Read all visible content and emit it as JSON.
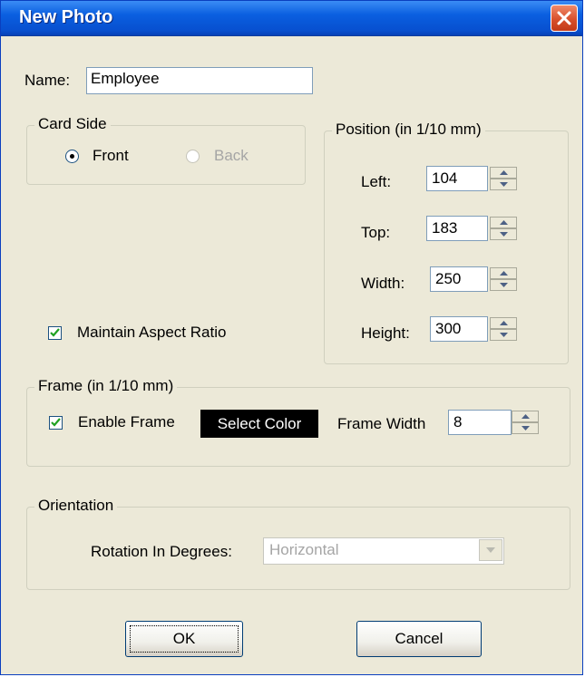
{
  "window": {
    "title": "New Photo"
  },
  "name": {
    "label": "Name:",
    "value": "Employee"
  },
  "card_side": {
    "legend": "Card Side",
    "front_label": "Front",
    "back_label": "Back",
    "selected": "Front"
  },
  "position": {
    "legend": "Position (in 1/10 mm)",
    "left_label": "Left:",
    "left_value": "104",
    "top_label": "Top:",
    "top_value": "183",
    "width_label": "Width:",
    "width_value": "250",
    "height_label": "Height:",
    "height_value": "300"
  },
  "maintain_aspect": {
    "label": "Maintain Aspect Ratio",
    "checked": true
  },
  "frame": {
    "legend": "Frame (in 1/10 mm)",
    "enable_label": "Enable Frame",
    "enabled": true,
    "select_color_label": "Select Color",
    "select_color_bg": "#000000",
    "width_label": "Frame Width",
    "width_value": "8"
  },
  "orientation": {
    "legend": "Orientation",
    "rotation_label": "Rotation In Degrees:",
    "rotation_value": "Horizontal"
  },
  "buttons": {
    "ok_label": "OK",
    "cancel_label": "Cancel"
  },
  "icons": {
    "close": "close-icon",
    "radio": "radio-icon",
    "check": "checkmark-icon",
    "spin_up": "chevron-up-icon",
    "spin_down": "chevron-down-icon",
    "dropdown": "chevron-down-icon"
  },
  "colors": {
    "title_bar": "#0a5fe0",
    "close_button": "#d8502c",
    "dialog_bg": "#ece9d8"
  }
}
